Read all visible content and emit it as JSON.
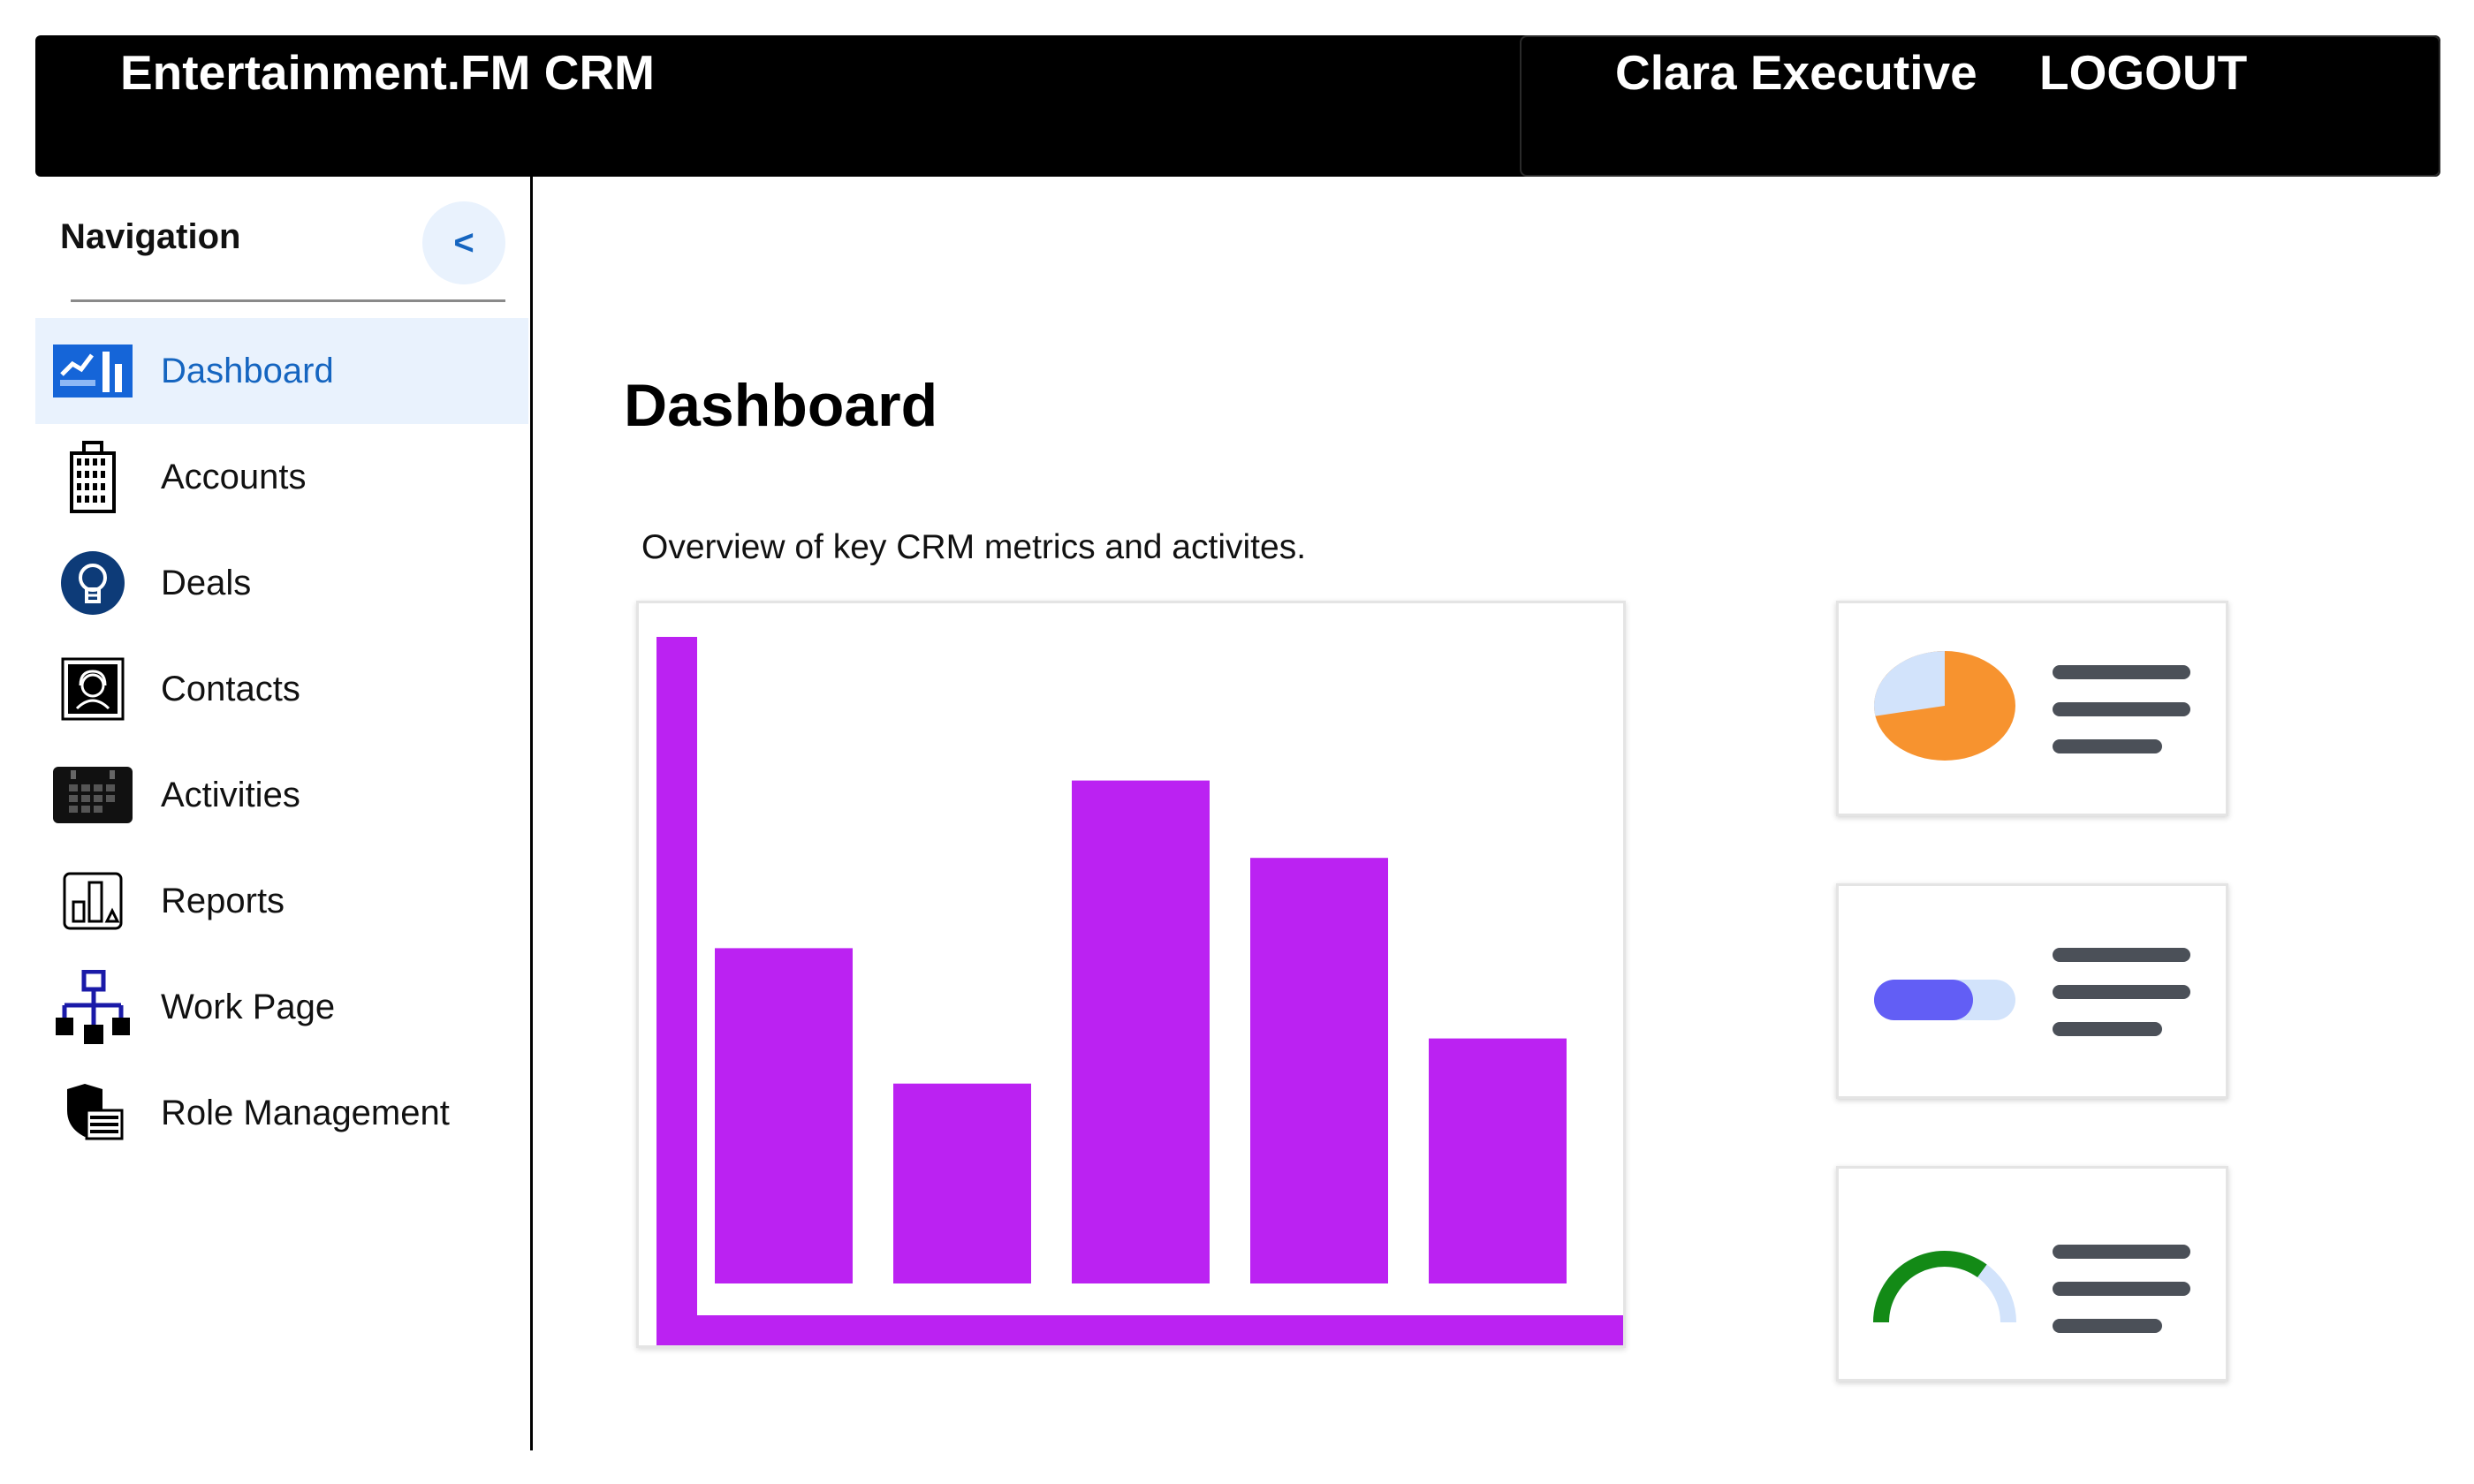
{
  "header": {
    "app_title": "Entertainment.FM CRM",
    "user_name": "Clara Executive",
    "logout_label": "LOGOUT"
  },
  "sidebar": {
    "heading": "Navigation",
    "collapse_label": "<",
    "items": [
      {
        "label": "Dashboard",
        "icon": "dashboard-chart-icon",
        "active": true
      },
      {
        "label": "Accounts",
        "icon": "building-icon",
        "active": false
      },
      {
        "label": "Deals",
        "icon": "lightbulb-icon",
        "active": false
      },
      {
        "label": "Contacts",
        "icon": "contact-headset-icon",
        "active": false
      },
      {
        "label": "Activities",
        "icon": "calendar-icon",
        "active": false
      },
      {
        "label": "Reports",
        "icon": "report-icon",
        "active": false
      },
      {
        "label": "Work Page",
        "icon": "org-chart-icon",
        "active": false
      },
      {
        "label": "Role Management",
        "icon": "shield-list-icon",
        "active": false
      }
    ]
  },
  "main": {
    "title": "Dashboard",
    "subtitle": "Overview of key CRM metrics and activites."
  },
  "chart_data": {
    "type": "bar",
    "values": [
      52,
      31,
      78,
      66,
      38
    ],
    "ylim": [
      0,
      100
    ],
    "color": "#bb22f2",
    "axis_color": "#bb22f2"
  },
  "widgets": [
    {
      "kind": "pie",
      "fraction": 0.28,
      "primary_color": "#f7932f",
      "secondary_color": "#d2e3fb"
    },
    {
      "kind": "progress",
      "fraction": 0.7,
      "primary_color": "#625ef5",
      "secondary_color": "#d2e3fb"
    },
    {
      "kind": "gauge",
      "fraction": 0.7,
      "primary_color": "#138a16",
      "secondary_color": "#d2e3fb"
    }
  ],
  "colors": {
    "header_bg": "#000000",
    "active_nav_bg": "#e9f2fd",
    "active_nav_text": "#1565c0",
    "line_placeholder": "#4b5058"
  }
}
